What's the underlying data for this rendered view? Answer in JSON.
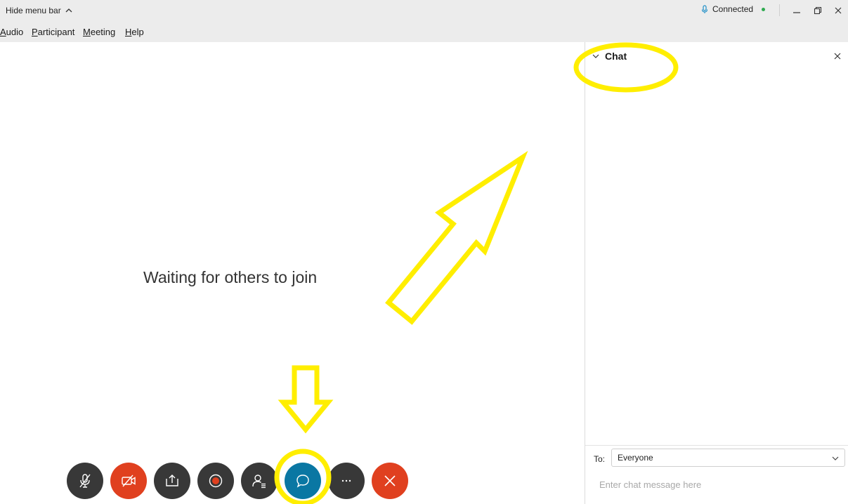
{
  "titlebar": {
    "hide_menu_label": "Hide menu bar",
    "status_text": "Connected",
    "status_color": "#2eaa4f"
  },
  "menubar": {
    "items": [
      {
        "label": "Audio",
        "mnemonic": "A"
      },
      {
        "label": "Participant",
        "mnemonic": "P"
      },
      {
        "label": "Meeting",
        "mnemonic": "M"
      },
      {
        "label": "Help",
        "mnemonic": "H"
      }
    ]
  },
  "stage": {
    "message": "Waiting for others to join"
  },
  "chat": {
    "title": "Chat",
    "to_label": "To:",
    "recipient": "Everyone",
    "input_placeholder": "Enter chat message here"
  },
  "controls": [
    {
      "icon": "mic-muted-icon",
      "color": "#383838"
    },
    {
      "icon": "video-off-icon",
      "color": "#e0401f"
    },
    {
      "icon": "share-icon",
      "color": "#383838"
    },
    {
      "icon": "record-icon",
      "color": "#383838"
    },
    {
      "icon": "participants-icon",
      "color": "#383838"
    },
    {
      "icon": "chat-icon",
      "color": "#0a77a3"
    },
    {
      "icon": "more-icon",
      "color": "#383838"
    },
    {
      "icon": "leave-icon",
      "color": "#e0401f"
    }
  ],
  "annotations": {
    "highlight_color": "#ffee00"
  }
}
